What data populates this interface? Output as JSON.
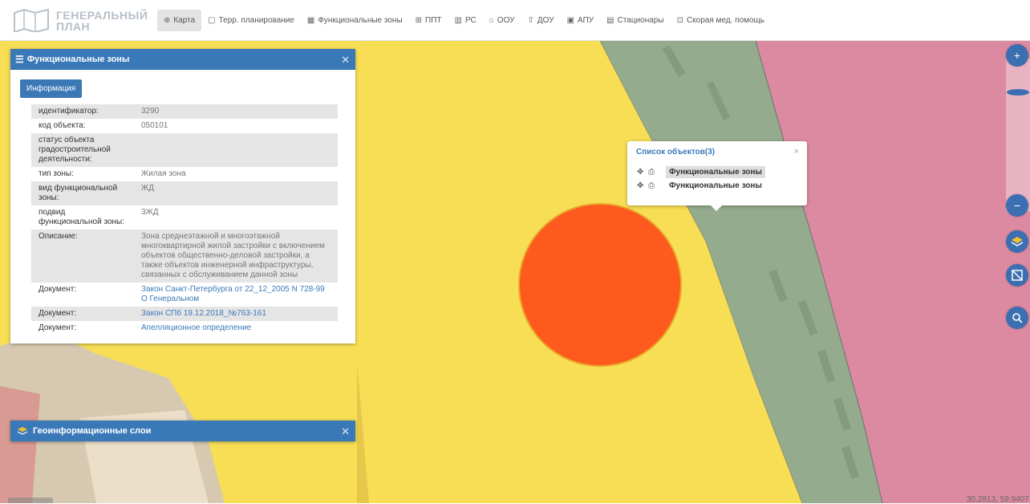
{
  "logo": {
    "line1": "ГЕНЕРАЛЬНЫЙ",
    "line2": "ПЛАН",
    "icon": "map-fold-icon"
  },
  "nav": [
    {
      "icon": "globe-icon",
      "glyph": "⊕",
      "label": "Карта",
      "active": true
    },
    {
      "icon": "document-icon",
      "glyph": "▢",
      "label": "Терр. планирование"
    },
    {
      "icon": "grid-icon",
      "glyph": "▦",
      "label": "Функциональные зоны"
    },
    {
      "icon": "table-icon",
      "glyph": "⊞",
      "label": "ППТ"
    },
    {
      "icon": "building-icon",
      "glyph": "▥",
      "label": "РС"
    },
    {
      "icon": "school-icon",
      "glyph": "⌂",
      "label": "ООУ"
    },
    {
      "icon": "kindergarten-icon",
      "glyph": "⇧",
      "label": "ДОУ"
    },
    {
      "icon": "image-icon",
      "glyph": "▣",
      "label": "АПУ"
    },
    {
      "icon": "hospital-icon",
      "glyph": "▤",
      "label": "Стационары"
    },
    {
      "icon": "ambulance-icon",
      "glyph": "⊡",
      "label": "Скорая мед. помощь"
    }
  ],
  "panel": {
    "title": "Функциональные зоны",
    "button": "Информация",
    "rows": [
      {
        "key": "идентификатор:",
        "value": "3290"
      },
      {
        "key": "код объекта:",
        "value": "050101"
      },
      {
        "key": "статус объекта градостроительной деятельности:",
        "value": ""
      },
      {
        "key": "тип зоны:",
        "value": "Жилая зона"
      },
      {
        "key": "вид функциональной зоны:",
        "value": "ЖД"
      },
      {
        "key": "подвид функциональной зоны:",
        "value": "3ЖД"
      },
      {
        "key": "Описание:",
        "value": "Зона среднеэтажной и многоэтажной многоквартирной жилой застройки с включением объектов общественно-деловой застройки, а также объектов инженерной инфраструктуры, связанных с обслуживанием данной зоны"
      },
      {
        "key": "Документ:",
        "value": "Закон Санкт-Петербурга от 22_12_2005 N 728-99 О Генеральном",
        "link": true
      },
      {
        "key": "Документ:",
        "value": "Закон СПб 19.12.2018_№763-161",
        "link": true
      },
      {
        "key": "Документ:",
        "value": "Апелляционное определение",
        "link": true
      }
    ]
  },
  "panel2": {
    "title": "Геоинформационные слои",
    "icon": "layers-icon"
  },
  "popup": {
    "title": "Список объектов(3)",
    "close": "×",
    "items": [
      {
        "label": "Функциональные зоны",
        "selected": true
      },
      {
        "label": "Функциональные зоны",
        "selected": false
      }
    ]
  },
  "coords": "30.2813, 59.9407",
  "colors": {
    "accent": "#3a79b8",
    "residential_yellow": "#f7de55",
    "green_zone": "#94ab8e",
    "pink_zone": "#dc8aa2",
    "marker": "#fe5a1d"
  }
}
